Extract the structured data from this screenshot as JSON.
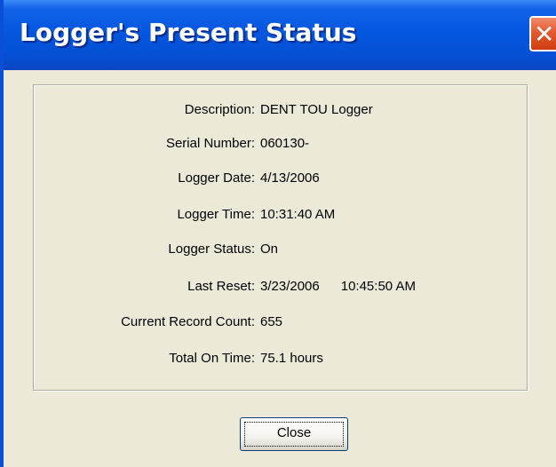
{
  "window": {
    "title": "Logger's Present Status",
    "close_glyph": "✕",
    "close_icon": "close-icon"
  },
  "fields": {
    "description": {
      "label": "Description:",
      "value": "DENT TOU Logger"
    },
    "serial_number": {
      "label": "Serial Number:",
      "value": "060130-"
    },
    "logger_date": {
      "label": "Logger Date:",
      "value": "4/13/2006"
    },
    "logger_time": {
      "label": "Logger Time:",
      "value": "10:31:40 AM"
    },
    "logger_status": {
      "label": "Logger Status:",
      "value": "On"
    },
    "last_reset": {
      "label": "Last Reset:",
      "date": "3/23/2006",
      "time": "10:45:50 AM"
    },
    "current_record_count": {
      "label": "Current Record Count:",
      "value": "655"
    },
    "total_on_time": {
      "label": "Total On Time:",
      "value": "75.1 hours"
    }
  },
  "buttons": {
    "close_label": "Close"
  },
  "colors": {
    "titlebar": "#0558e0",
    "window_bg": "#ece9d8",
    "close_button": "#e35a30"
  }
}
